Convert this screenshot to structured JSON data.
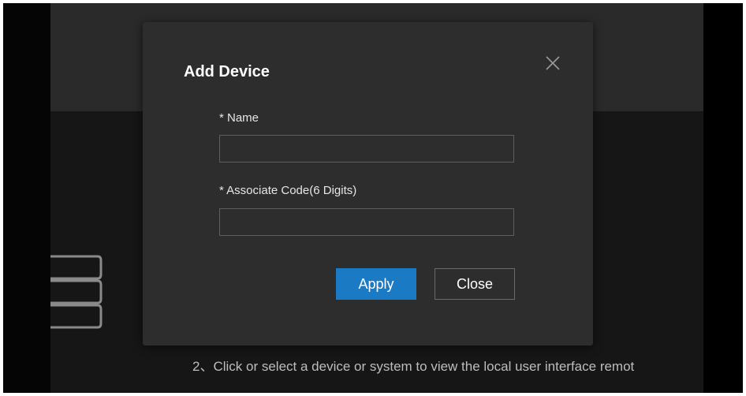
{
  "background": {
    "instruction_text": "2、Click or select a device or system to view the local user interface remot"
  },
  "dialog": {
    "title": "Add Device",
    "close_icon": "close-icon",
    "fields": {
      "name": {
        "label": "* Name",
        "value": "",
        "placeholder": ""
      },
      "associate_code": {
        "label": "* Associate Code(6 Digits)",
        "value": "",
        "placeholder": ""
      }
    },
    "buttons": {
      "apply": "Apply",
      "close": "Close"
    }
  },
  "colors": {
    "dialog_bg": "#2d2d2d",
    "primary_button": "#1a7ac4",
    "page_header": "#2a2a2a",
    "page_body": "#161616"
  }
}
